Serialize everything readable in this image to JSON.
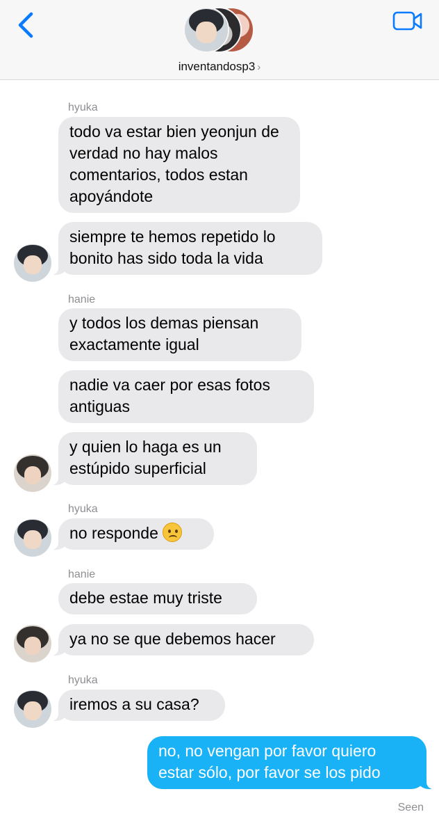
{
  "header": {
    "title": "inventandosp3",
    "accent_color": "#0a7aff"
  },
  "messages": [
    {
      "sender": "hyuka",
      "text": "todo va estar bien yeonjun de verdad no hay malos comentarios, todos estan apoyándote"
    },
    {
      "text": "siempre te hemos repetido lo bonito has sido toda la vida"
    },
    {
      "sender": "hanie",
      "text": "y todos los demas piensan exactamente igual"
    },
    {
      "text": "nadie va caer por esas fotos antiguas"
    },
    {
      "text": "y quien lo haga es un estúpido superficial"
    },
    {
      "sender": "hyuka",
      "text": "no responde",
      "emoji": "frowning-face-emoji"
    },
    {
      "sender": "hanie",
      "text": "debe estae muy triste"
    },
    {
      "text": "ya no se que debemos hacer"
    },
    {
      "sender": "hyuka",
      "text": "iremos a su casa?"
    },
    {
      "text": "no, no vengan por favor quiero estar sólo, por favor se los pido",
      "outgoing": true
    }
  ],
  "status": {
    "seen": "Seen"
  },
  "colors": {
    "incoming_bubble": "#e9e9eb",
    "outgoing_bubble": "#1ab2f6"
  }
}
